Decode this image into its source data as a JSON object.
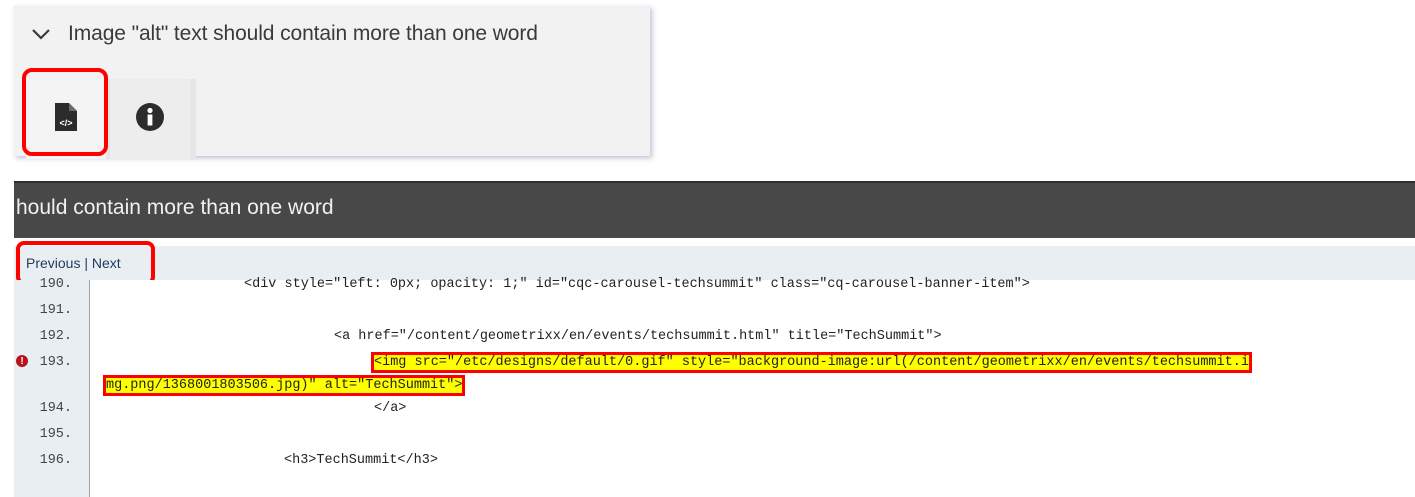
{
  "issue": {
    "title": "Image \"alt\" text should contain more than one word",
    "expand_icon": "chevron-down-icon",
    "buttons": [
      {
        "icon": "file-code-icon",
        "label": "View source"
      },
      {
        "icon": "info-circle-icon",
        "label": "Info"
      }
    ]
  },
  "viewer": {
    "title": "hould contain more than one word",
    "nav": {
      "previous": "Previous",
      "separator": " | ",
      "next": "Next"
    },
    "lines": [
      {
        "num": "190.",
        "text": "<div style=\"left: 0px; opacity: 1;\" id=\"cqc-carousel-techsummit\" class=\"cq-carousel-banner-item\">"
      },
      {
        "num": "191.",
        "text": ""
      },
      {
        "num": "192.",
        "text": "<a href=\"/content/geometrixx/en/events/techsummit.html\" title=\"TechSummit\">"
      },
      {
        "num": "193.",
        "text": "<img src=\"/etc/designs/default/0.gif\" style=\"background-image:url(/content/geometrixx/en/events/techsummit.i",
        "error": true
      },
      {
        "num": "",
        "text": "mg.png/1368001803506.jpg)\" alt=\"TechSummit\">"
      },
      {
        "num": "194.",
        "text": "</a>"
      },
      {
        "num": "195.",
        "text": ""
      },
      {
        "num": "196.",
        "text": "<h3>TechSummit</h3>"
      }
    ],
    "error_marker": "!"
  }
}
